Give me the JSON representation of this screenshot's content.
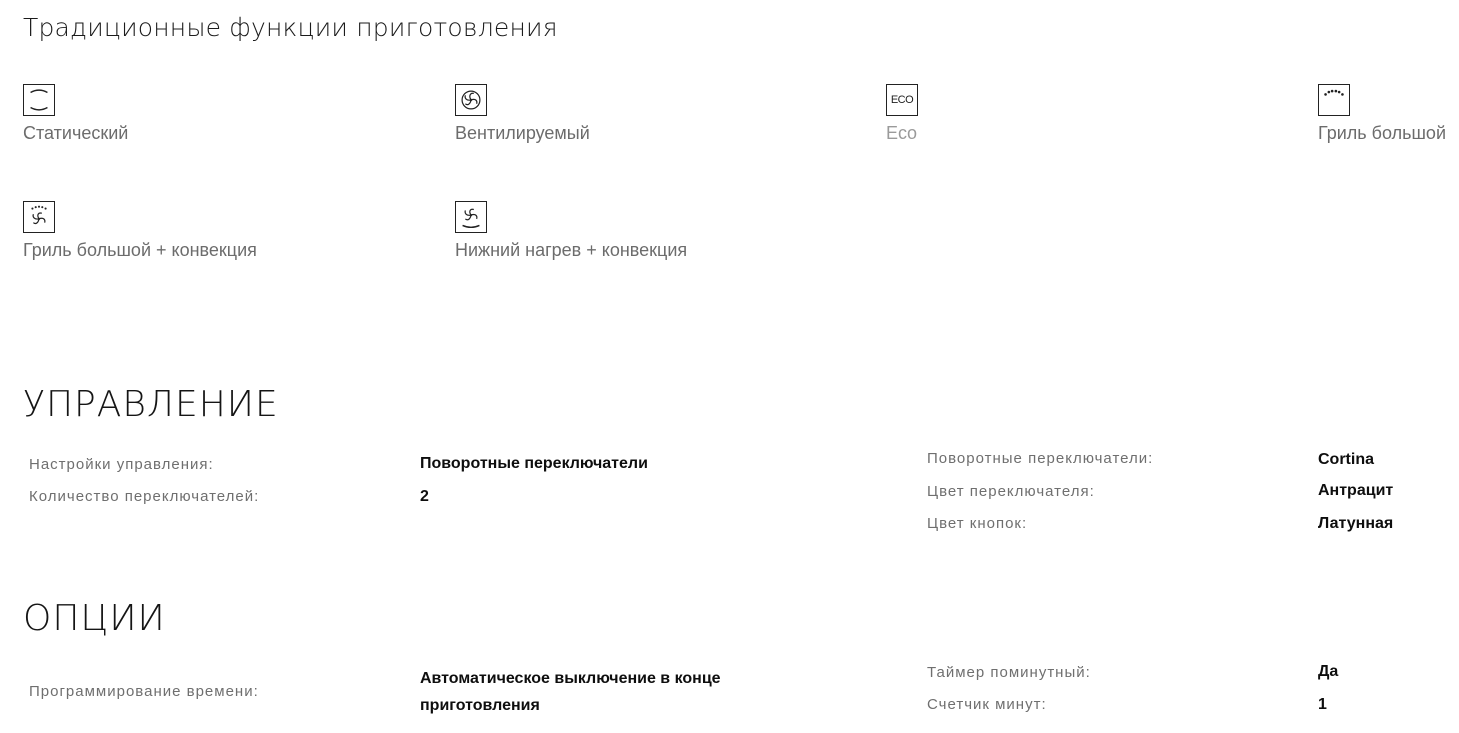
{
  "section_functions": {
    "title": "Традиционные функции приготовления",
    "items": [
      {
        "label": "Статический",
        "icon": "static-heat-icon"
      },
      {
        "label": "Вентилируемый",
        "icon": "fan-icon"
      },
      {
        "label": "Eco",
        "icon": "eco-icon",
        "icon_text": "ECO"
      },
      {
        "label": "Гриль большой",
        "icon": "large-grill-icon"
      },
      {
        "label": "Гриль большой + конвекция",
        "icon": "grill-convection-icon"
      },
      {
        "label": "Нижний нагрев + конвекция",
        "icon": "bottom-heat-convection-icon"
      }
    ]
  },
  "section_control": {
    "title": "УПРАВЛЕНИЕ",
    "left": [
      {
        "label": "Настройки управления:",
        "value": "Поворотные переключатели"
      },
      {
        "label": "Количество переключателей:",
        "value": "2"
      }
    ],
    "right": [
      {
        "label": "Поворотные переключатели:",
        "value": "Cortina"
      },
      {
        "label": "Цвет переключателя:",
        "value": "Антрацит"
      },
      {
        "label": "Цвет кнопок:",
        "value": "Латунная"
      }
    ]
  },
  "section_options": {
    "title": "ОПЦИИ",
    "left": [
      {
        "label": "Программирование времени:",
        "value": "Автоматическое выключение в конце приготовления"
      }
    ],
    "right": [
      {
        "label": "Таймер поминутный:",
        "value": "Да"
      },
      {
        "label": "Счетчик минут:",
        "value": "1"
      }
    ]
  }
}
